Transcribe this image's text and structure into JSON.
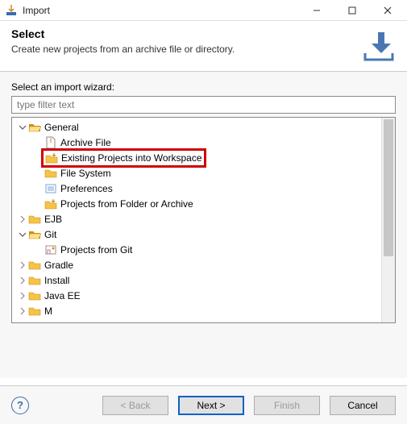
{
  "window": {
    "title": "Import"
  },
  "header": {
    "title": "Select",
    "subtitle": "Create new projects from an archive file or directory."
  },
  "wizard": {
    "label": "Select an import wizard:",
    "filter_placeholder": "type filter text"
  },
  "tree": {
    "general": {
      "label": "General",
      "archive_file": "Archive File",
      "existing_projects": "Existing Projects into Workspace",
      "file_system": "File System",
      "preferences": "Preferences",
      "projects_from_folder": "Projects from Folder or Archive"
    },
    "ejb": "EJB",
    "git": {
      "label": "Git",
      "projects_from_git": "Projects from Git"
    },
    "gradle": "Gradle",
    "install": "Install",
    "javaee": "Java EE",
    "truncated": "M"
  },
  "buttons": {
    "back": "< Back",
    "next": "Next >",
    "finish": "Finish",
    "cancel": "Cancel"
  }
}
